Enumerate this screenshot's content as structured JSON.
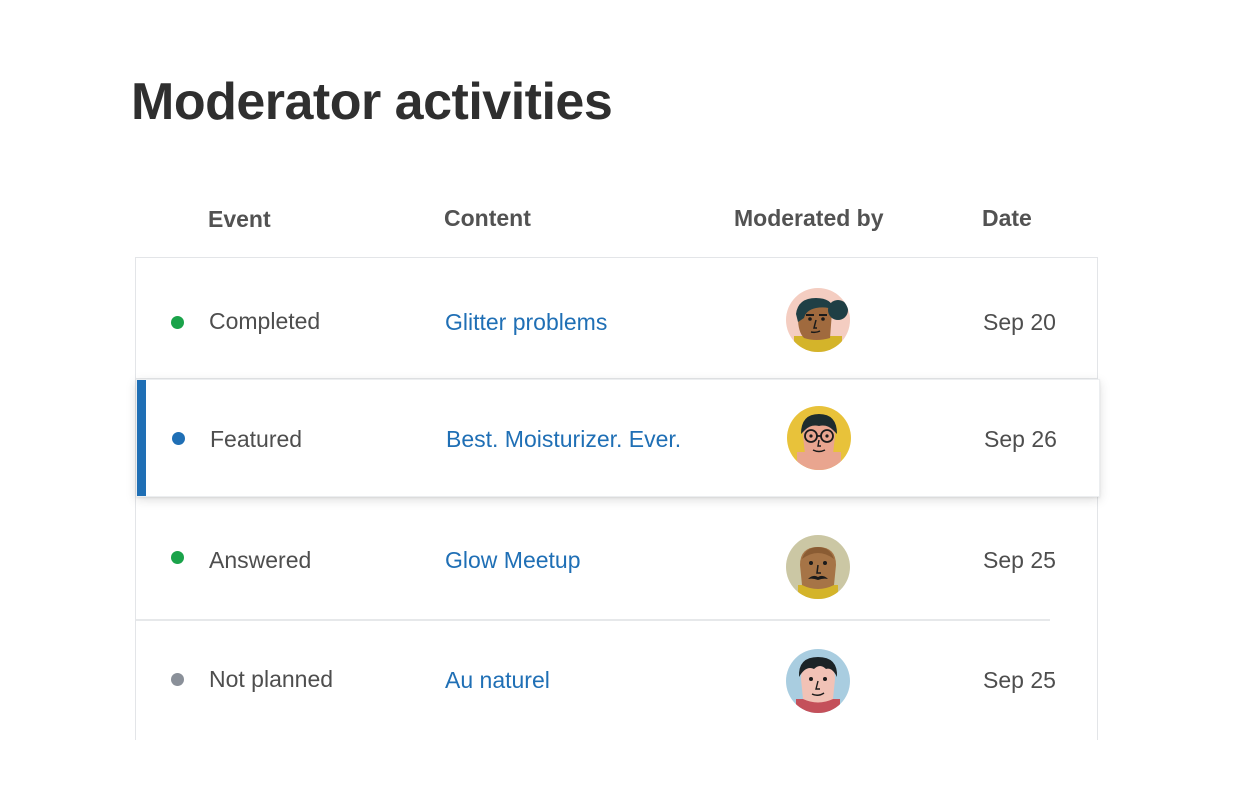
{
  "page": {
    "title": "Moderator activities"
  },
  "table": {
    "columns": {
      "event": "Event",
      "content": "Content",
      "moderated_by": "Moderated by",
      "date": "Date"
    },
    "rows": [
      {
        "event": "Completed",
        "status_color": "#1aa34a",
        "content": "Glitter problems",
        "avatar_icon": "woman-ponytail-avatar",
        "date": "Sep 20"
      },
      {
        "event": "Featured",
        "status_color": "#1f6fb5",
        "content": "Best. Moisturizer. Ever.",
        "avatar_icon": "man-glasses-avatar",
        "date": "Sep 26",
        "selected": true
      },
      {
        "event": "Answered",
        "status_color": "#1aa34a",
        "content": "Glow Meetup",
        "avatar_icon": "man-mustache-avatar",
        "date": "Sep 25"
      },
      {
        "event": "Not planned",
        "status_color": "#8a9099",
        "content": "Au naturel",
        "avatar_icon": "man-black-hair-avatar",
        "date": "Sep 25"
      }
    ]
  },
  "colors": {
    "accent": "#1f6fb5",
    "link": "#1f6fb5",
    "completed": "#1aa34a",
    "not_planned": "#8a9099"
  }
}
